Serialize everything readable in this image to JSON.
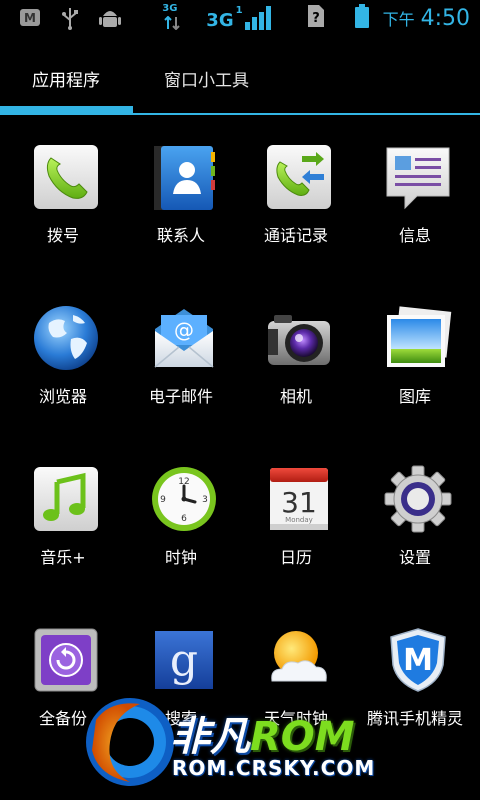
{
  "status_bar": {
    "net_small": "3G",
    "net_main": "3G",
    "net_sub": "1",
    "ampm": "下午",
    "time": "4:50",
    "icons": [
      "m-icon",
      "usb-icon",
      "android-debug-icon",
      "data-transfer-icon",
      "signal-icon",
      "no-sim-icon",
      "battery-icon"
    ]
  },
  "tabs": [
    {
      "label": "应用程序",
      "selected": true
    },
    {
      "label": "窗口小工具",
      "selected": false
    }
  ],
  "colors": {
    "accent": "#33b5e5",
    "background": "#000000"
  },
  "apps": [
    {
      "label": "拨号",
      "icon": "phone-icon"
    },
    {
      "label": "联系人",
      "icon": "contacts-icon"
    },
    {
      "label": "通话记录",
      "icon": "call-log-icon"
    },
    {
      "label": "信息",
      "icon": "messaging-icon"
    },
    {
      "label": "浏览器",
      "icon": "browser-globe-icon"
    },
    {
      "label": "电子邮件",
      "icon": "email-icon"
    },
    {
      "label": "相机",
      "icon": "camera-icon"
    },
    {
      "label": "图库",
      "icon": "gallery-icon"
    },
    {
      "label": "音乐+",
      "icon": "music-icon"
    },
    {
      "label": "时钟",
      "icon": "clock-icon"
    },
    {
      "label": "日历",
      "icon": "calendar-icon"
    },
    {
      "label": "设置",
      "icon": "settings-gear-icon"
    },
    {
      "label": "全备份",
      "icon": "backup-safe-icon"
    },
    {
      "label": "搜索",
      "icon": "google-search-icon"
    },
    {
      "label": "天气时钟",
      "icon": "weather-icon"
    },
    {
      "label": "腾讯手机精灵",
      "icon": "tencent-shield-icon"
    }
  ],
  "calendar_icon": {
    "day": "31",
    "weekday": "Monday"
  },
  "clock_icon": {
    "n12": "12",
    "n9": "9",
    "n3": "3",
    "n6": "6"
  },
  "watermark": {
    "brand_cn": "非凡",
    "brand_rom": "ROM",
    "url": "ROM.CRSKY.COM"
  }
}
